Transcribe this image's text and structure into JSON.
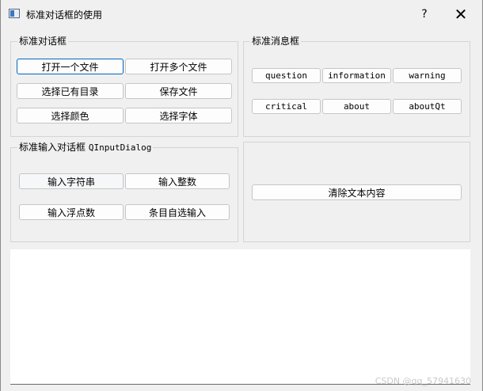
{
  "window": {
    "title": "标准对话框的使用",
    "help_label": "?",
    "close_label": "✕"
  },
  "standard_dialogs": {
    "title": "标准对话框",
    "buttons": {
      "open_file": "打开一个文件",
      "open_files": "打开多个文件",
      "select_dir": "选择已有目录",
      "save_file": "保存文件",
      "select_color": "选择颜色",
      "select_font": "选择字体"
    }
  },
  "message_boxes": {
    "title": "标准消息框",
    "buttons": {
      "question": "question",
      "information": "information",
      "warning": "warning",
      "critical": "critical",
      "about": "about",
      "aboutqt": "aboutQt"
    }
  },
  "input_dialogs": {
    "title_cn": "标准输入对话框",
    "title_class": "QInputDialog",
    "buttons": {
      "input_string": "输入字符串",
      "input_int": "输入整数",
      "input_float": "输入浮点数",
      "input_item": "条目自选输入"
    }
  },
  "actions": {
    "clear_text": "清除文本内容"
  },
  "text_area": {
    "content": ""
  },
  "watermark": "CSDN @qq_57941630"
}
